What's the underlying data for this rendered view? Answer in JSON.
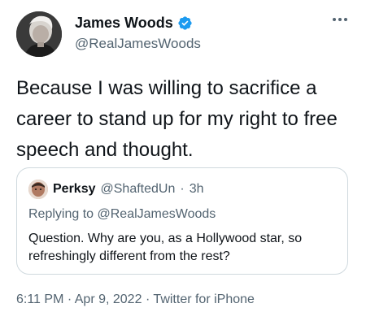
{
  "author": {
    "display_name": "James Woods",
    "handle": "@RealJamesWoods",
    "verified_icon": "verified-badge-icon",
    "verified_color": "#1d9bf0"
  },
  "tweet": {
    "text": "Because I was willing to sacrifice a career to stand up for my right to free speech and thought."
  },
  "quote": {
    "display_name": "Perksy",
    "handle": "@ShaftedUn",
    "separator": "·",
    "time": "3h",
    "replying_to_prefix": "Replying to",
    "replying_to_handle": "@RealJamesWoods",
    "text": "Question. Why are you, as a Hollywood star, so refreshingly different from the rest?"
  },
  "meta": {
    "time": "6:11 PM",
    "sep1": "·",
    "date": "Apr 9, 2022",
    "sep2": "·",
    "source": "Twitter for iPhone"
  },
  "icons": {
    "more": "more-options-icon"
  },
  "colors": {
    "text_primary": "#0f1419",
    "text_secondary": "#536471",
    "border": "#cfd9de",
    "accent": "#1d9bf0"
  }
}
